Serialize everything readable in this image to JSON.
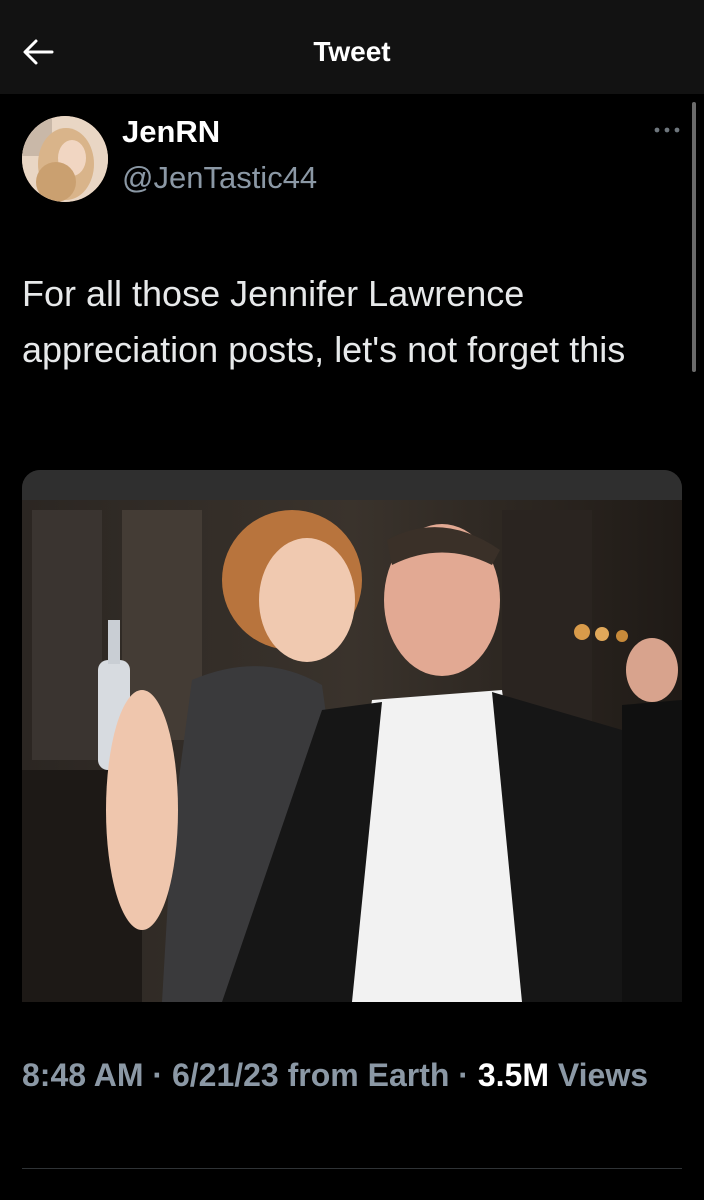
{
  "header": {
    "title": "Tweet"
  },
  "tweet": {
    "display_name": "JenRN",
    "handle": "@JenTastic44",
    "text": "For all those Jennifer Lawrence appreciation posts, let's not forget this",
    "time": "8:48 AM",
    "separator": "·",
    "date": "6/21/23",
    "source": "from Earth",
    "views_count": "3.5M",
    "views_label": "Views"
  },
  "icons": {
    "back": "back-arrow-icon",
    "more": "more-options-icon"
  },
  "colors": {
    "background": "#000000",
    "header": "#121212",
    "secondary_text": "#8b98a5",
    "primary_text": "#e7e9ea"
  }
}
